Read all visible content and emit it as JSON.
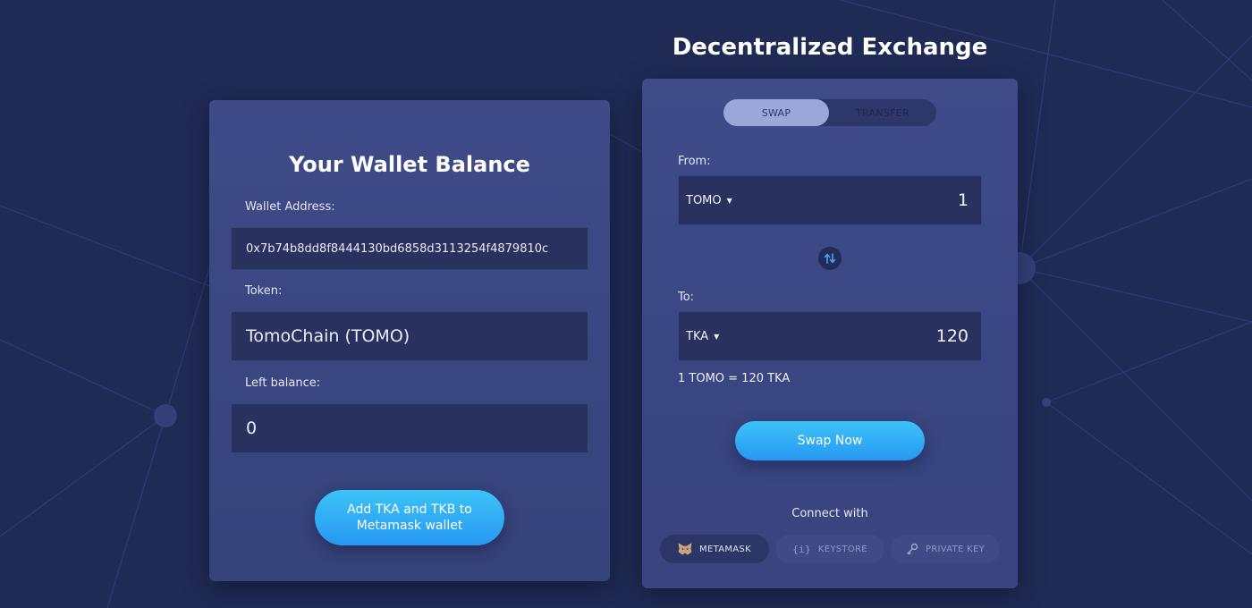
{
  "wallet": {
    "title": "Your Wallet Balance",
    "address_label": "Wallet Address:",
    "address_value": "0x7b74b8dd8f8444130bd6858d3113254f4879810c",
    "token_label": "Token:",
    "token_value": "TomoChain (TOMO)",
    "balance_label": "Left balance:",
    "balance_value": "0",
    "add_button_line1": "Add TKA and TKB to",
    "add_button_line2": "Metamask wallet"
  },
  "exchange": {
    "title": "Decentralized Exchange",
    "tabs": [
      {
        "label": "SWAP",
        "active": true
      },
      {
        "label": "TRANSFER",
        "active": false
      }
    ],
    "from_label": "From:",
    "from_token": "TOMO",
    "from_amount": "1",
    "to_label": "To:",
    "to_token": "TKA",
    "to_amount": "120",
    "rate": "1 TOMO = 120 TKA",
    "swap_button": "Swap Now",
    "connect_label": "Connect with",
    "connect_options": [
      {
        "label": "METAMASK",
        "icon": "fox-icon"
      },
      {
        "label": "KEYSTORE",
        "icon": "keystore-icon"
      },
      {
        "label": "PRIVATE KEY",
        "icon": "key-icon"
      }
    ]
  },
  "colors": {
    "background": "#1f2a55",
    "card": "#3f4b88",
    "field": "#29325f",
    "accent": "#2fa9f5",
    "active_tab": "#9ba7d8"
  }
}
